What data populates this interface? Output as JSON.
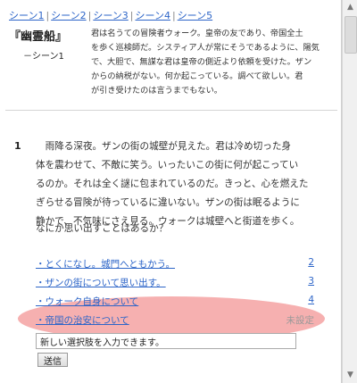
{
  "scene_nav": [
    "シーン1",
    "シーン2",
    "シーン3",
    "シーン4",
    "シーン5"
  ],
  "title": "『幽霊船』",
  "subtitle": "－シーン1",
  "intro_lines": [
    "君は名うての冒険者ウォーク。皇帝の友であり、帝国全土",
    "を歩く巡検師だ。システィア人が常にそうであるように、陽気",
    "で、大胆で、無謀な君は皇帝の側近より依頼を受けた。ザン",
    "からの納税がない。何か起こっている。調べて欲しい。君",
    "が引き受けたのは言うまでもない。"
  ],
  "passage_number": "1",
  "passage_lines": [
    "雨降る深夜。ザンの街の城壁が見えた。君は冷め切った身",
    "体を震わせて、不敵に笑う。いったいこの街に何が起こってい",
    "るのか。それは全く謎に包まれているのだ。きっと、心を燃えた",
    "ぎらせる冒険が待っているに違いない。ザンの街は眠るように",
    "静かで、不気味にさえ見る。ウォークは城壁へと街道を歩く。"
  ],
  "question": "なにか思い出すことはあるか？",
  "choices": [
    {
      "label": "・とくになし。城門へともかう。",
      "count": "2"
    },
    {
      "label": "・ザンの街について思い出す。",
      "count": "3"
    },
    {
      "label": "・ウォーク自身について",
      "count": "4"
    },
    {
      "label": "・帝国の治安について",
      "count": "未設定"
    }
  ],
  "input_value": "新しい選択肢を入力できます。",
  "send_label": "送信",
  "highlight_color": "#f4a2a2",
  "link_color": "#2d65c8"
}
